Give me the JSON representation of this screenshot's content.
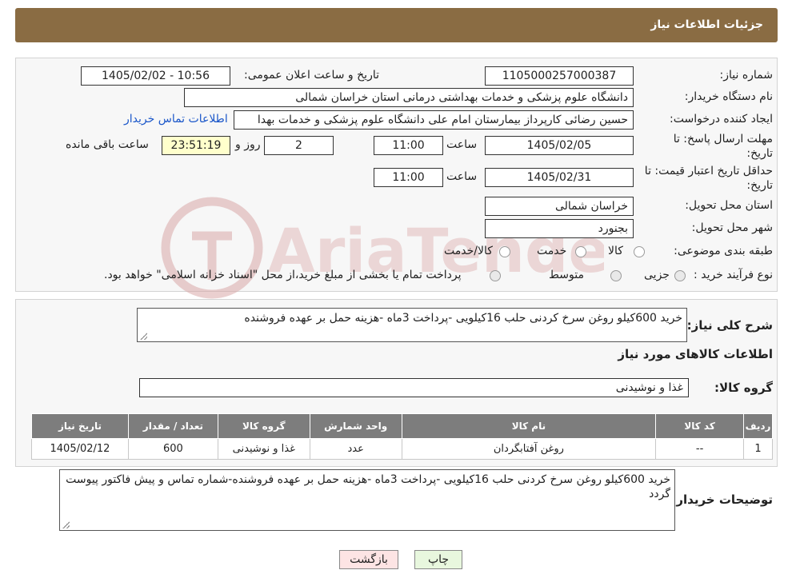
{
  "header": {
    "title": "جزئیات اطلاعات نیاز"
  },
  "form": {
    "need_number_label": "شماره نیاز:",
    "need_number": "1105000257000387",
    "announce_label": "تاریخ و ساعت اعلان عمومی:",
    "announce_value": "1405/02/02 - 10:56",
    "buyer_org_label": "نام دستگاه خریدار:",
    "buyer_org": "دانشگاه علوم پزشکی و خدمات بهداشتی درمانی استان خراسان شمالی",
    "creator_label": "ایجاد کننده درخواست:",
    "creator": "حسین رضائی کارپرداز بیمارستان امام علی دانشگاه علوم پزشکی و خدمات بهدا",
    "contact_link": "اطلاعات تماس خریدار",
    "deadline_label_1": "مهلت ارسال پاسخ: تا",
    "deadline_label_2": "تاریخ:",
    "deadline_date": "1405/02/05",
    "time_label": "ساعت",
    "deadline_time": "11:00",
    "days_value": "2",
    "days_label": "روز و",
    "remaining_time": "23:51:19",
    "remaining_label": "ساعت باقی مانده",
    "validity_label_1": "حداقل تاریخ اعتبار قیمت: تا",
    "validity_label_2": "تاریخ:",
    "validity_date": "1405/02/31",
    "validity_time_label": "ساعت",
    "validity_time": "11:00",
    "province_label": "استان محل تحویل:",
    "province": "خراسان شمالی",
    "city_label": "شهر محل تحویل:",
    "city": "بجنورد",
    "category_label": "طبقه بندی موضوعی:",
    "category_options": [
      "کالا",
      "خدمت",
      "کالا/خدمت"
    ],
    "process_label": "نوع فرآیند خرید :",
    "process_options": [
      "جزیی",
      "متوسط"
    ],
    "payment_note": "پرداخت تمام یا بخشی از مبلغ خرید،از محل \"اسناد خزانه اسلامی\" خواهد بود."
  },
  "summary": {
    "label": "شرح کلی نیاز:",
    "text": "خرید 600کیلو روغن سرخ کردنی حلب 16کیلویی -پرداخت 3ماه -هزینه حمل بر عهده فروشنده",
    "goods_info_title": "اطلاعات کالاهای مورد نیاز",
    "goods_group_label": "گروه کالا:",
    "goods_group": "غذا و نوشیدنی"
  },
  "table": {
    "headers": [
      "ردیف",
      "کد کالا",
      "نام کالا",
      "واحد شمارش",
      "گروه کالا",
      "تعداد / مقدار",
      "تاریخ نیاز"
    ],
    "rows": [
      [
        "1",
        "--",
        "روغن آفتابگردان",
        "عدد",
        "غذا و نوشیدنی",
        "600",
        "1405/02/12"
      ]
    ]
  },
  "notes": {
    "label": "توضیحات خریدار:",
    "text": "خرید 600کیلو روغن سرخ کردنی حلب 16کیلویی -پرداخت 3ماه -هزینه حمل بر عهده فروشنده-شماره تماس و پیش فاکتور پیوست گردد"
  },
  "buttons": {
    "print": "چاپ",
    "back": "بازگشت"
  },
  "watermark": {
    "text": "AriaTender.neT"
  },
  "colors": {
    "header_bg": "#8a6c43",
    "table_header_bg": "#7d7d7d",
    "link": "#1a56c9",
    "print_bg": "#e8f7de",
    "back_bg": "#fde4e4"
  }
}
